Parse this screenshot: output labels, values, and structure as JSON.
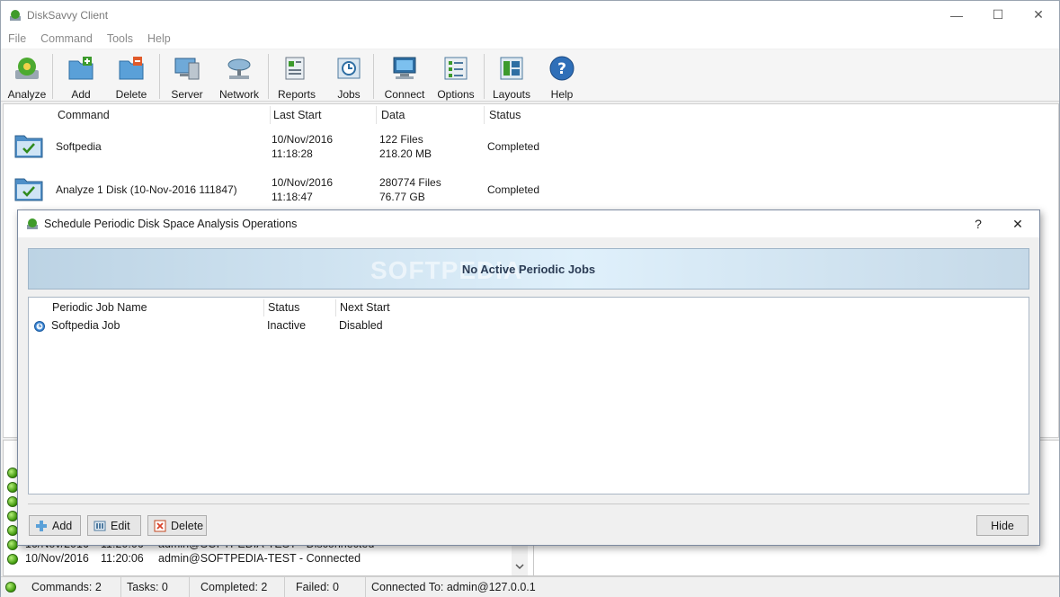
{
  "window": {
    "title": "DiskSavvy Client",
    "min_glyph": "—",
    "max_glyph": "☐",
    "close_glyph": "✕"
  },
  "menu": [
    "File",
    "Command",
    "Tools",
    "Help"
  ],
  "toolbar": [
    {
      "label": "Analyze",
      "icon": "analyze-icon"
    },
    {
      "label": "Add",
      "icon": "add-folder-icon"
    },
    {
      "label": "Delete",
      "icon": "delete-folder-icon"
    },
    {
      "label": "Server",
      "icon": "server-icon"
    },
    {
      "label": "Network",
      "icon": "network-icon"
    },
    {
      "label": "Reports",
      "icon": "reports-icon"
    },
    {
      "label": "Jobs",
      "icon": "jobs-icon"
    },
    {
      "label": "Connect",
      "icon": "connect-icon"
    },
    {
      "label": "Options",
      "icon": "options-icon"
    },
    {
      "label": "Layouts",
      "icon": "layouts-icon"
    },
    {
      "label": "Help",
      "icon": "help-icon"
    }
  ],
  "commands": {
    "columns": [
      "Command",
      "Last Start",
      "Data",
      "Status"
    ],
    "rows": [
      {
        "command": "Softpedia",
        "date": "10/Nov/2016",
        "time": "11:18:28",
        "files": "122 Files",
        "size": "218.20 MB",
        "status": "Completed"
      },
      {
        "command": "Analyze 1 Disk (10-Nov-2016 111847)",
        "date": "10/Nov/2016",
        "time": "11:18:47",
        "files": "280774 Files",
        "size": "76.77 GB",
        "status": "Completed"
      }
    ]
  },
  "log": {
    "partial": {
      "date": "10/Nov/2016",
      "time": "11:20:06",
      "message": "admin@SOFTPEDIA-TEST - Disconnected"
    },
    "last": {
      "date": "10/Nov/2016",
      "time": "11:20:06",
      "message": "admin@SOFTPEDIA-TEST - Connected"
    }
  },
  "status_bar": {
    "commands": "Commands: 2",
    "tasks": "Tasks: 0",
    "completed": "Completed: 2",
    "failed": "Failed: 0",
    "connected": "Connected To: admin@127.0.0.1"
  },
  "dialog": {
    "title": "Schedule Periodic Disk Space Analysis Operations",
    "help_glyph": "?",
    "close_glyph": "✕",
    "banner": "No Active Periodic Jobs",
    "watermark": "SOFTPEDIA",
    "columns": [
      "Periodic Job Name",
      "Status",
      "Next Start"
    ],
    "jobs": [
      {
        "name": "Softpedia Job",
        "status": "Inactive",
        "next_start": "Disabled"
      }
    ],
    "buttons": {
      "add": "Add",
      "edit": "Edit",
      "delete": "Delete",
      "hide": "Hide"
    }
  },
  "colors": {
    "accent": "#2b3c55",
    "status_ok": "#3e9a0a"
  }
}
